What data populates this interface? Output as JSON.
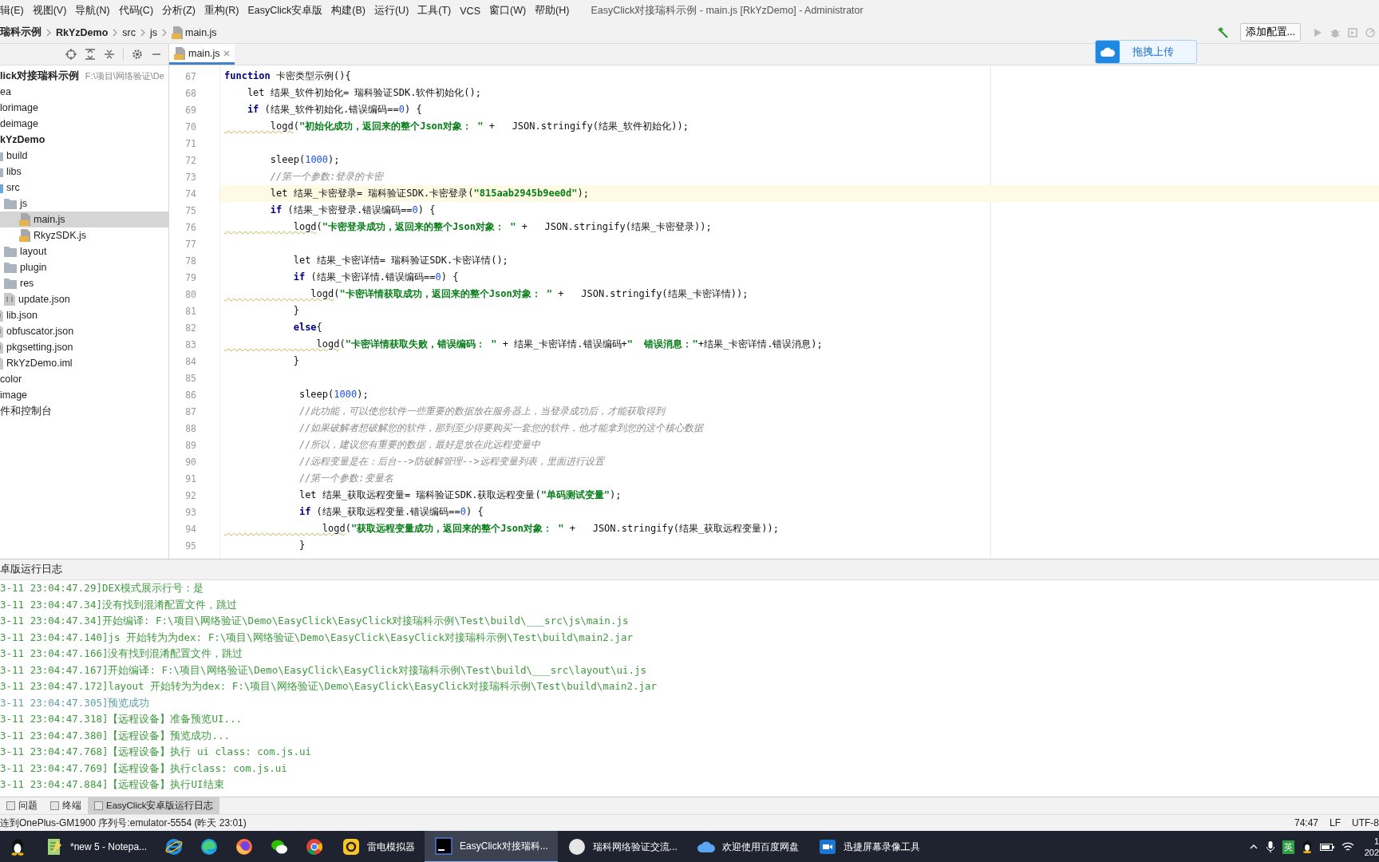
{
  "menu_bar": {
    "items": [
      "辑(E)",
      "视图(V)",
      "导航(N)",
      "代码(C)",
      "分析(Z)",
      "重构(R)",
      "EasyClick安卓版",
      "构建(B)",
      "运行(U)",
      "工具(T)",
      "VCS",
      "窗口(W)",
      "帮助(H)"
    ],
    "title": "EasyClick对接瑞科示例 - main.js [RkYzDemo] - Administrator"
  },
  "navigation_bar": {
    "breadcrumbs": [
      {
        "label": "瑞科示例",
        "kind": "project"
      },
      {
        "label": "RkYzDemo",
        "kind": "module"
      },
      {
        "label": "src",
        "kind": "folder"
      },
      {
        "label": "js",
        "kind": "folder"
      },
      {
        "label": "main.js",
        "kind": "file"
      }
    ],
    "run_config": "添加配置..."
  },
  "upload_widget": {
    "label": "拖拽上传"
  },
  "project_panel": {
    "tree": [
      {
        "label": "lick对接瑞科示例",
        "path": "F:\\项目\\网络验证\\De",
        "kind": "project",
        "selected": false,
        "children": [
          {
            "label": "ea",
            "kind": "folder",
            "selected": false
          },
          {
            "label": "lorimage",
            "kind": "folder",
            "selected": false
          },
          {
            "label": "deimage",
            "kind": "folder",
            "selected": false
          },
          {
            "label": "kYzDemo",
            "kind": "module",
            "selected": false,
            "children": [
              {
                "label": "build",
                "kind": "folder",
                "selected": false
              },
              {
                "label": "libs",
                "kind": "folder",
                "selected": false
              },
              {
                "label": "src",
                "kind": "source",
                "selected": false,
                "children": [
                  {
                    "label": "js",
                    "kind": "folder",
                    "selected": false,
                    "children": [
                      {
                        "label": "main.js",
                        "kind": "js",
                        "selected": true
                      },
                      {
                        "label": "RkyzSDK.js",
                        "kind": "js",
                        "selected": false
                      }
                    ]
                  },
                  {
                    "label": "layout",
                    "kind": "folder",
                    "selected": false
                  },
                  {
                    "label": "plugin",
                    "kind": "folder",
                    "selected": false
                  },
                  {
                    "label": "res",
                    "kind": "folder",
                    "selected": false
                  },
                  {
                    "label": "update.json",
                    "kind": "json",
                    "selected": false
                  }
                ]
              },
              {
                "label": "lib.json",
                "kind": "json",
                "selected": false
              },
              {
                "label": "obfuscator.json",
                "kind": "json",
                "selected": false
              },
              {
                "label": "pkgsetting.json",
                "kind": "json",
                "selected": false
              },
              {
                "label": "RkYzDemo.iml",
                "kind": "iml",
                "selected": false
              }
            ]
          },
          {
            "label": "color",
            "kind": "folder",
            "selected": false
          },
          {
            "label": "image",
            "kind": "folder",
            "selected": false
          }
        ]
      },
      {
        "label": "件和控制台",
        "kind": "scratch",
        "selected": false
      }
    ]
  },
  "editor": {
    "tabs": [
      {
        "label": "main.js",
        "selected": true
      }
    ],
    "lines": [
      {
        "number": "67",
        "current": false,
        "segments": [
          {
            "kind": "kw",
            "text": "function"
          },
          {
            "kind": "plain",
            "text": " 卡密类型示例(){"
          }
        ]
      },
      {
        "number": "68",
        "current": false,
        "segments": [
          {
            "kind": "plain",
            "text": "    let 结果_软件初始化= 瑞科验证SDK.软件初始化();"
          }
        ]
      },
      {
        "number": "69",
        "current": false,
        "segments": [
          {
            "kind": "kw",
            "text": "    if"
          },
          {
            "kind": "plain",
            "text": " (结果_软件初始化.错误编码=="
          },
          {
            "kind": "num",
            "text": "0"
          },
          {
            "kind": "plain",
            "text": ") {"
          }
        ]
      },
      {
        "number": "70",
        "current": false,
        "segments": [
          {
            "kind": "call",
            "text": "        logd"
          },
          {
            "kind": "plain",
            "text": "("
          },
          {
            "kind": "str",
            "text": "\"初始化成功，返回来的整个Json对象： \""
          },
          {
            "kind": "plain",
            "text": " +   JSON.stringify(结果_软件初始化));"
          }
        ]
      },
      {
        "number": "71",
        "current": false
      },
      {
        "number": "72",
        "current": false,
        "segments": [
          {
            "kind": "plain",
            "text": "        sleep("
          },
          {
            "kind": "num",
            "text": "1000"
          },
          {
            "kind": "plain",
            "text": ");"
          }
        ]
      },
      {
        "number": "73",
        "current": false,
        "segments": [
          {
            "kind": "cmt",
            "text": "        //第一个参数:登录的卡密"
          }
        ]
      },
      {
        "number": "74",
        "current": true,
        "segments": [
          {
            "kind": "plain",
            "text": "        let 结果_卡密登录= 瑞科验证SDK.卡密登录("
          },
          {
            "kind": "str",
            "text": "\"815aab2945b9ee0d\""
          },
          {
            "kind": "plain",
            "text": ");"
          }
        ]
      },
      {
        "number": "75",
        "current": false,
        "segments": [
          {
            "kind": "kw",
            "text": "        if"
          },
          {
            "kind": "plain",
            "text": " (结果_卡密登录.错误编码=="
          },
          {
            "kind": "num",
            "text": "0"
          },
          {
            "kind": "plain",
            "text": ") {"
          }
        ]
      },
      {
        "number": "76",
        "current": false,
        "segments": [
          {
            "kind": "call",
            "text": "            logd"
          },
          {
            "kind": "plain",
            "text": "("
          },
          {
            "kind": "str",
            "text": "\"卡密登录成功，返回来的整个Json对象： \""
          },
          {
            "kind": "plain",
            "text": " +   JSON.stringify(结果_卡密登录));"
          }
        ]
      },
      {
        "number": "77",
        "current": false
      },
      {
        "number": "78",
        "current": false,
        "segments": [
          {
            "kind": "plain",
            "text": "            let 结果_卡密详情= 瑞科验证SDK.卡密详情();"
          }
        ]
      },
      {
        "number": "79",
        "current": false,
        "segments": [
          {
            "kind": "kw",
            "text": "            if"
          },
          {
            "kind": "plain",
            "text": " (结果_卡密详情.错误编码=="
          },
          {
            "kind": "num",
            "text": "0"
          },
          {
            "kind": "plain",
            "text": ") {"
          }
        ]
      },
      {
        "number": "80",
        "current": false,
        "segments": [
          {
            "kind": "call",
            "text": "               logd"
          },
          {
            "kind": "plain",
            "text": "("
          },
          {
            "kind": "str",
            "text": "\"卡密详情获取成功，返回来的整个Json对象： \""
          },
          {
            "kind": "plain",
            "text": " +   JSON.stringify(结果_卡密详情));"
          }
        ]
      },
      {
        "number": "81",
        "current": false,
        "segments": [
          {
            "kind": "plain",
            "text": "            }"
          }
        ]
      },
      {
        "number": "82",
        "current": false,
        "segments": [
          {
            "kind": "kw",
            "text": "            else"
          },
          {
            "kind": "plain",
            "text": "{"
          }
        ]
      },
      {
        "number": "83",
        "current": false,
        "segments": [
          {
            "kind": "call",
            "text": "                logd"
          },
          {
            "kind": "plain",
            "text": "("
          },
          {
            "kind": "str",
            "text": "\"卡密详情获取失败，错误编码： \""
          },
          {
            "kind": "plain",
            "text": " + 结果_卡密详情.错误编码+"
          },
          {
            "kind": "str",
            "text": "\"  错误消息：\""
          },
          {
            "kind": "plain",
            "text": "+结果_卡密详情.错误消息);"
          }
        ]
      },
      {
        "number": "84",
        "current": false,
        "segments": [
          {
            "kind": "plain",
            "text": "            }"
          }
        ]
      },
      {
        "number": "85",
        "current": false
      },
      {
        "number": "86",
        "current": false,
        "segments": [
          {
            "kind": "plain",
            "text": "             sleep("
          },
          {
            "kind": "num",
            "text": "1000"
          },
          {
            "kind": "plain",
            "text": ");"
          }
        ]
      },
      {
        "number": "87",
        "current": false,
        "segments": [
          {
            "kind": "cmt",
            "text": "             //此功能，可以使您软件一些重要的数据放在服务器上，当登录成功后，才能获取得到"
          }
        ]
      },
      {
        "number": "88",
        "current": false,
        "segments": [
          {
            "kind": "cmt",
            "text": "             //如果破解者想破解您的软件，那到至少得要购买一套您的软件，他才能拿到您的这个核心数据"
          }
        ]
      },
      {
        "number": "89",
        "current": false,
        "segments": [
          {
            "kind": "cmt",
            "text": "             //所以，建议您有重要的数据，最好是放在此远程变量中"
          }
        ]
      },
      {
        "number": "90",
        "current": false,
        "segments": [
          {
            "kind": "cmt",
            "text": "             //远程变量是在：后台-->防破解管理-->远程变量列表，里面进行设置"
          }
        ]
      },
      {
        "number": "91",
        "current": false,
        "segments": [
          {
            "kind": "cmt",
            "text": "             //第一个参数:变量名"
          }
        ]
      },
      {
        "number": "92",
        "current": false,
        "segments": [
          {
            "kind": "plain",
            "text": "             let 结果_获取远程变量= 瑞科验证SDK.获取远程变量("
          },
          {
            "kind": "str",
            "text": "\"单码测试变量\""
          },
          {
            "kind": "plain",
            "text": ");"
          }
        ]
      },
      {
        "number": "93",
        "current": false,
        "segments": [
          {
            "kind": "kw",
            "text": "             if"
          },
          {
            "kind": "plain",
            "text": " (结果_获取远程变量.错误编码=="
          },
          {
            "kind": "num",
            "text": "0"
          },
          {
            "kind": "plain",
            "text": ") {"
          }
        ]
      },
      {
        "number": "94",
        "current": false,
        "segments": [
          {
            "kind": "call",
            "text": "                 logd"
          },
          {
            "kind": "plain",
            "text": "("
          },
          {
            "kind": "str",
            "text": "\"获取远程变量成功，返回来的整个Json对象： \""
          },
          {
            "kind": "plain",
            "text": " +   JSON.stringify(结果_获取远程变量));"
          }
        ]
      },
      {
        "number": "95",
        "current": false,
        "segments": [
          {
            "kind": "plain",
            "text": "             }"
          }
        ]
      }
    ]
  },
  "run_log": {
    "title": "卓版运行日志",
    "lines": [
      {
        "text": "3-11 23:04:47.29]DEX模式展示行号：是",
        "color": "#3f9a3f"
      },
      {
        "text": "3-11 23:04:47.34]没有找到混淆配置文件，跳过",
        "color": "#3f9a3f"
      },
      {
        "text": "3-11 23:04:47.34]开始编译: F:\\项目\\网络验证\\Demo\\EasyClick\\EasyClick对接瑞科示例\\Test\\build\\___src\\js\\main.js",
        "color": "#3f9a3f"
      },
      {
        "text": "3-11 23:04:47.140]js 开始转为为dex: F:\\项目\\网络验证\\Demo\\EasyClick\\EasyClick对接瑞科示例\\Test\\build\\main2.jar",
        "color": "#3f9a3f"
      },
      {
        "text": "3-11 23:04:47.166]没有找到混淆配置文件，跳过",
        "color": "#3f9a3f"
      },
      {
        "text": "3-11 23:04:47.167]开始编译: F:\\项目\\网络验证\\Demo\\EasyClick\\EasyClick对接瑞科示例\\Test\\build\\___src\\layout\\ui.js",
        "color": "#3f9a3f"
      },
      {
        "text": "3-11 23:04:47.172]layout 开始转为为dex: F:\\项目\\网络验证\\Demo\\EasyClick\\EasyClick对接瑞科示例\\Test\\build\\main2.jar",
        "color": "#3f9a3f"
      },
      {
        "text": "3-11 23:04:47.305]预览成功",
        "color": "#5c9fa3"
      },
      {
        "text": "3-11 23:04:47.318]【远程设备】准备预览UI...",
        "color": "#3f9a3f"
      },
      {
        "text": "3-11 23:04:47.380]【远程设备】预览成功...",
        "color": "#3f9a3f"
      },
      {
        "text": "3-11 23:04:47.768]【远程设备】执行 ui class: com.js.ui",
        "color": "#3f9a3f"
      },
      {
        "text": "3-11 23:04:47.769]【远程设备】执行class: com.js.ui",
        "color": "#3f9a3f"
      },
      {
        "text": "3-11 23:04:47.884]【远程设备】执行UI结束",
        "color": "#3f9a3f"
      }
    ]
  },
  "tool_tabs": [
    {
      "label": "问题",
      "selected": false
    },
    {
      "label": "终端",
      "selected": false
    },
    {
      "label": "EasyClick安卓版运行日志",
      "selected": true
    }
  ],
  "status_bar": {
    "message": "连到OnePlus-GM1900 序列号:emulator-5554 (昨天 23:01)",
    "position": "74:47",
    "line_separator": "LF",
    "encoding": "UTF-8"
  },
  "taskbar": {
    "items": [
      {
        "kind": "qq",
        "selected": false
      },
      {
        "kind": "notepad",
        "label": "*new 5 - Notepa...",
        "selected": false
      },
      {
        "kind": "ie",
        "selected": false
      },
      {
        "kind": "edge",
        "selected": false
      },
      {
        "kind": "firefox",
        "selected": false
      },
      {
        "kind": "wechat",
        "selected": false
      },
      {
        "kind": "chrome",
        "selected": false
      },
      {
        "kind": "emulator",
        "label": "雷电模拟器",
        "selected": false
      },
      {
        "kind": "ide",
        "label": "EasyClick对接瑞科...",
        "selected": true
      },
      {
        "kind": "chat",
        "label": "瑞科网络验证交流...",
        "selected": false
      },
      {
        "kind": "cloud",
        "label": "欢迎使用百度网盘",
        "selected": false
      },
      {
        "kind": "recorder",
        "label": "迅捷屏幕录像工具",
        "selected": false
      }
    ],
    "input_method": "英",
    "clock": [
      "1",
      "202"
    ]
  }
}
